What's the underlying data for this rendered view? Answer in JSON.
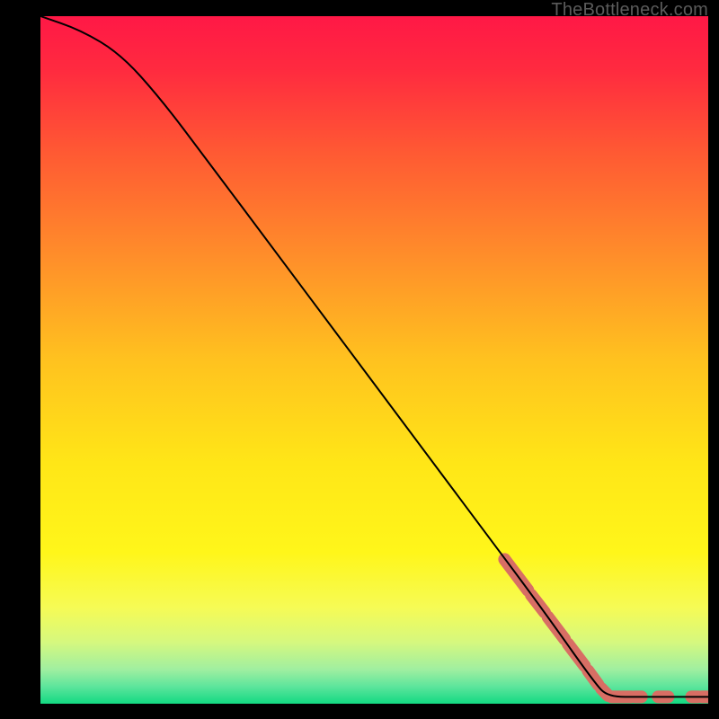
{
  "watermark": "TheBottleneck.com",
  "chart_data": {
    "type": "line",
    "title": "",
    "xlabel": "",
    "ylabel": "",
    "xlim": [
      0,
      100
    ],
    "ylim": [
      0,
      100
    ],
    "curve": [
      {
        "x": 0,
        "y": 100
      },
      {
        "x": 6,
        "y": 98
      },
      {
        "x": 12,
        "y": 94.5
      },
      {
        "x": 18,
        "y": 88
      },
      {
        "x": 25,
        "y": 79
      },
      {
        "x": 35,
        "y": 66
      },
      {
        "x": 45,
        "y": 53
      },
      {
        "x": 55,
        "y": 40
      },
      {
        "x": 65,
        "y": 27
      },
      {
        "x": 75,
        "y": 14
      },
      {
        "x": 83,
        "y": 3
      },
      {
        "x": 85,
        "y": 1
      },
      {
        "x": 90,
        "y": 1
      },
      {
        "x": 100,
        "y": 1
      }
    ],
    "highlight_segments": [
      {
        "x1": 69.5,
        "y1": 21.0,
        "x2": 73.0,
        "y2": 16.5
      },
      {
        "x1": 73.5,
        "y1": 15.8,
        "x2": 75.5,
        "y2": 13.3
      },
      {
        "x1": 76.0,
        "y1": 12.6,
        "x2": 78.5,
        "y2": 9.4
      },
      {
        "x1": 79.0,
        "y1": 8.7,
        "x2": 81.5,
        "y2": 5.5
      },
      {
        "x1": 82.0,
        "y1": 4.8,
        "x2": 83.5,
        "y2": 2.8
      },
      {
        "x1": 84.0,
        "y1": 2.2,
        "x2": 85.0,
        "y2": 1.2
      },
      {
        "x1": 85.5,
        "y1": 1.0,
        "x2": 88.5,
        "y2": 1.0
      },
      {
        "x1": 89.0,
        "y1": 1.0,
        "x2": 90.0,
        "y2": 1.0
      },
      {
        "x1": 92.5,
        "y1": 1.0,
        "x2": 94.0,
        "y2": 1.0
      },
      {
        "x1": 97.5,
        "y1": 1.0,
        "x2": 98.5,
        "y2": 1.0
      },
      {
        "x1": 99.0,
        "y1": 1.0,
        "x2": 100.0,
        "y2": 1.0
      }
    ],
    "gradient_stops": [
      {
        "offset": 0.0,
        "color": "#ff1846"
      },
      {
        "offset": 0.08,
        "color": "#ff2b3f"
      },
      {
        "offset": 0.2,
        "color": "#ff5a33"
      },
      {
        "offset": 0.35,
        "color": "#ff8e2a"
      },
      {
        "offset": 0.5,
        "color": "#ffc21f"
      },
      {
        "offset": 0.65,
        "color": "#ffe617"
      },
      {
        "offset": 0.78,
        "color": "#fff61a"
      },
      {
        "offset": 0.86,
        "color": "#f6fb55"
      },
      {
        "offset": 0.91,
        "color": "#d6f87e"
      },
      {
        "offset": 0.95,
        "color": "#a0efa0"
      },
      {
        "offset": 0.975,
        "color": "#5de59c"
      },
      {
        "offset": 1.0,
        "color": "#13d982"
      }
    ],
    "highlight_color": "#d86e64",
    "curve_color": "#000000"
  }
}
